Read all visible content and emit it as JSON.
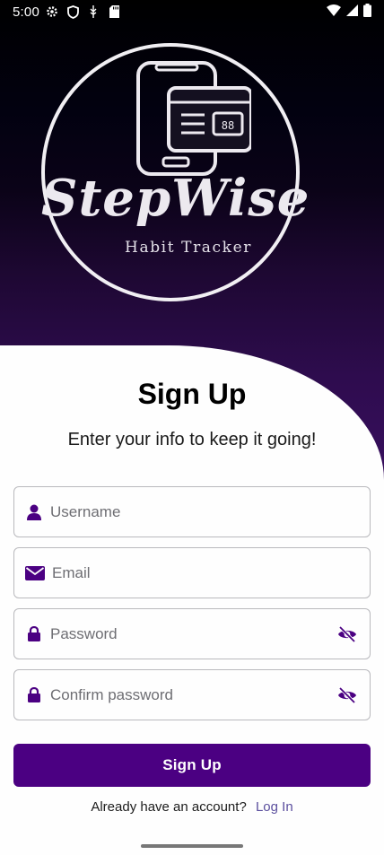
{
  "status_bar": {
    "time": "5:00",
    "left_icons": [
      "gear-icon",
      "shield-icon",
      "usb-icon",
      "sd-card-icon"
    ],
    "right_icons": [
      "wifi-icon",
      "signal-icon",
      "battery-icon"
    ]
  },
  "logo": {
    "title": "StepWise",
    "subtitle": "Habit Tracker"
  },
  "form": {
    "title": "Sign Up",
    "subtitle": "Enter your info to keep it going!",
    "username_placeholder": "Username",
    "email_placeholder": "Email",
    "password_placeholder": "Password",
    "confirm_placeholder": "Confirm password",
    "submit_label": "Sign Up"
  },
  "footer": {
    "prompt": "Already have an account?",
    "link": "Log In"
  },
  "colors": {
    "accent": "#4b0082",
    "link": "#5b4f9e",
    "hero_top": "#000000",
    "hero_bottom": "#3a0f62"
  }
}
